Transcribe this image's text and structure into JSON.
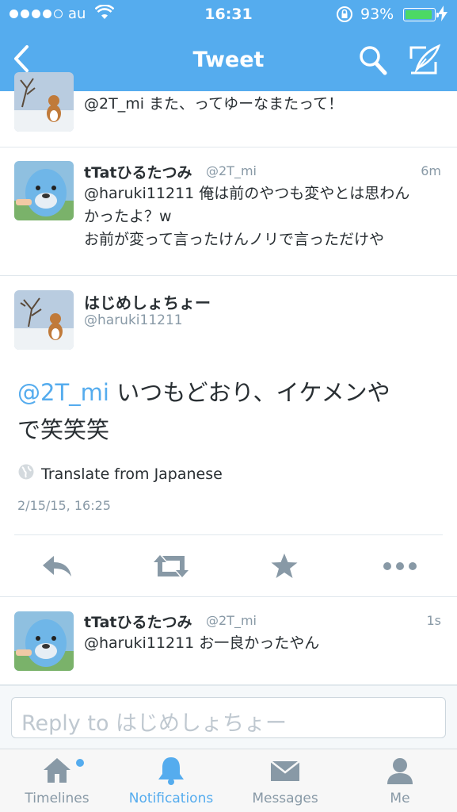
{
  "status_bar": {
    "carrier": "au",
    "time": "16:31",
    "battery_percent": "93%",
    "battery_level": 0.93
  },
  "nav": {
    "title": "Tweet",
    "icons": [
      "back-chevron-icon",
      "search-icon",
      "compose-icon"
    ]
  },
  "tweets_above": [
    {
      "text": "@2T_mi また、ってゆーなまたって！"
    },
    {
      "name": "tTatひるたつみ",
      "handle": "@2T_mi",
      "time": "6m",
      "line1": "@haruki11211 俺は前のやつも変やとは思わん",
      "line2": "かったよ？w",
      "line3": "お前が変って言ったけんノリで言っただけや"
    }
  ],
  "main_tweet": {
    "name": "はじめしょちょー",
    "handle": "@haruki11211",
    "mention": "@2T_mi",
    "text_line1": " いつもどおり、イケメンや",
    "text_line2": "で笑笑笑",
    "translate_label": "Translate from Japanese",
    "date": "2/15/15, 16:25",
    "actions": [
      "reply-icon",
      "retweet-icon",
      "favorite-star-icon",
      "more-icon"
    ]
  },
  "reply_tweet": {
    "name": "tTatひるたつみ",
    "handle": "@2T_mi",
    "time": "1s",
    "text": "@haruki11211 お一良かったやん"
  },
  "reply_box": {
    "placeholder": "Reply to はじめしょちょー"
  },
  "tabs": [
    {
      "label": "Timelines",
      "icon": "home-icon",
      "active": false,
      "badge": true
    },
    {
      "label": "Notifications",
      "icon": "bell-icon",
      "active": true
    },
    {
      "label": "Messages",
      "icon": "envelope-icon",
      "active": false
    },
    {
      "label": "Me",
      "icon": "person-icon",
      "active": false
    }
  ],
  "colors": {
    "brand": "#55acee",
    "battery": "#4cd964",
    "text": "#292f33",
    "muted": "#8899a6"
  }
}
